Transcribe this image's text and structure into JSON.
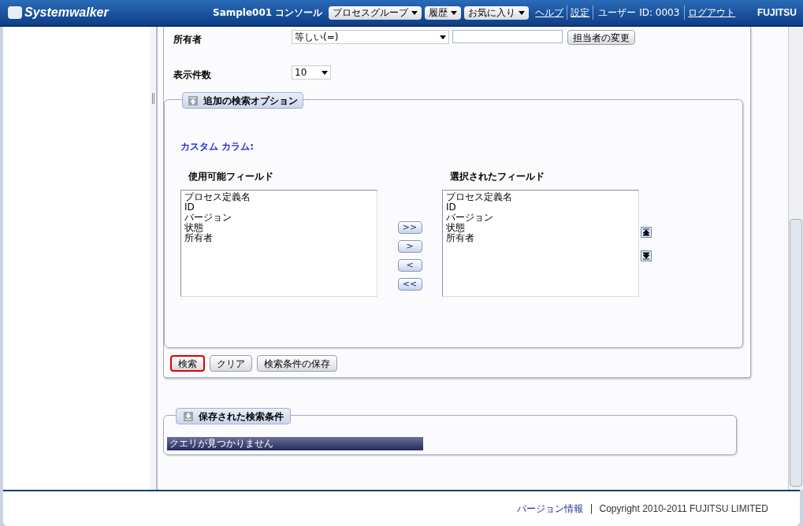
{
  "header": {
    "logo": "Systemwalker",
    "title": "Sample001 コンソール",
    "menus": [
      {
        "label": "プロセスグループ"
      },
      {
        "label": "履歴"
      },
      {
        "label": "お気に入り"
      }
    ],
    "links": [
      {
        "label": "ヘルプ"
      },
      {
        "label": "設定"
      }
    ],
    "user": "ユーザー ID: 0003",
    "logout": "ログアウト",
    "brand": "FUJITSU"
  },
  "filters": [
    {
      "label": "所有者",
      "operator": "等しい(=)",
      "button": "担当者の変更",
      "kind": "owner"
    },
    {
      "label": "表示件数",
      "operator": "10",
      "kind": "count"
    }
  ],
  "options": {
    "legend": "追加の検索オプション",
    "custom_label": "カスタム カラム:",
    "available": {
      "heading": "使用可能フィールド",
      "items": [
        "プロセス定義名",
        "ID",
        "バージョン",
        "状態",
        "所有者"
      ]
    },
    "selected": {
      "heading": "選択されたフィールド",
      "items": [
        "プロセス定義名",
        "ID",
        "バージョン",
        "状態",
        "所有者"
      ]
    },
    "transfer_buttons": [
      ">>",
      ">",
      "<",
      "<<"
    ]
  },
  "actions": [
    {
      "label": "検索",
      "focused": true
    },
    {
      "label": "クリア",
      "focused": false
    },
    {
      "label": "検索条件の保存",
      "focused": false
    }
  ],
  "saved": {
    "legend": "保存された検索条件",
    "message": "クエリが見つかりません"
  },
  "footer": {
    "link": "バージョン情報",
    "separator": "|",
    "copyright": "Copyright 2010-2011 FUJITSU LIMITED"
  }
}
